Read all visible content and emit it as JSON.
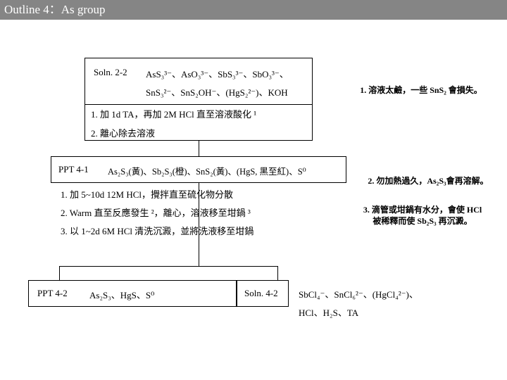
{
  "header": {
    "title": "Outline 4：As group"
  },
  "soln22": {
    "label": "Soln. 2-2",
    "ions_line1": "AsS₃³⁻、AsO₃³⁻、SbS₃³⁻、SbO₃³⁻、",
    "ions_line2": "SnS₃²⁻、SnS₂OH⁻、(HgS₂²⁻)、KOH",
    "step1": "1.  加 1d TA，再加 2M HCl 直至溶液酸化 ¹",
    "step2": "2.  離心除去溶液"
  },
  "ppt41": {
    "label": "PPT 4-1",
    "content": "As₂S₃(黃)、Sb₂S₃(橙)、SnS₂(黃)、(HgS, 黑至紅)、S⁰",
    "step1": "1.  加 5~10d 12M HCl，攪拌直至硫化物分散",
    "step2": "2.  Warm 直至反應發生 ²，離心，溶液移至坩鍋 ³",
    "step3": "3.  以 1~2d 6M HCl 清洗沉澱，並將洗液移至坩鍋"
  },
  "ppt42": {
    "label": "PPT 4-2",
    "content": "As₂S₃、HgS、S⁰"
  },
  "soln42": {
    "label": "Soln. 4-2",
    "content_line1": "SbCl₄⁻、SnCl₆²⁻、(HgCl₄²⁻)、",
    "content_line2": "HCl、H₂S、TA"
  },
  "notes": {
    "note1": "1. 溶液太鹼，一些 SnS₂ 會損失。",
    "note2": "2. 勿加熱過久，As₂S₃會再溶解。",
    "note3_line1": "3. 滴管或坩鍋有水分，會使 HCl",
    "note3_line2": "被稀釋而使 Sb₂S₃ 再沉澱。"
  }
}
